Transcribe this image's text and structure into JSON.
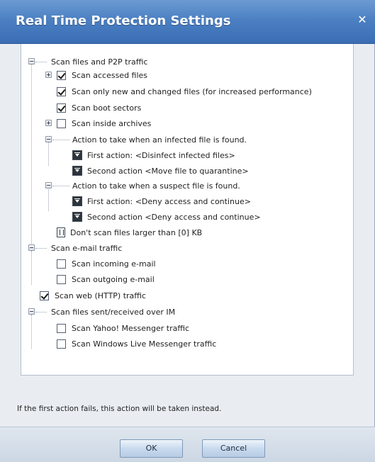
{
  "dialog": {
    "title": "Real Time Protection Settings",
    "close_label": "✕",
    "help_text": "If the first action fails, this action will be taken instead.",
    "ok_label": "OK",
    "cancel_label": "Cancel"
  },
  "tree": {
    "scan_files_p2p": "Scan files and P2P traffic",
    "scan_accessed": "Scan accessed files",
    "scan_new_changed": "Scan only new and changed files (for increased performance)",
    "scan_boot": "Scan boot sectors",
    "scan_archives": "Scan inside archives",
    "action_infected": "Action to take when an infected file is found.",
    "infected_first": "First action: <Disinfect infected files>",
    "infected_second": "Second action <Move file to quarantine>",
    "action_suspect": "Action to take when a suspect file is found.",
    "suspect_first": "First action: <Deny access and continue>",
    "suspect_second": "Second action <Deny access and continue>",
    "max_size": "Don't scan files larger than [0] KB",
    "scan_email": "Scan e-mail traffic",
    "scan_incoming": "Scan incoming e-mail",
    "scan_outgoing": "Scan outgoing e-mail",
    "scan_web": "Scan web (HTTP) traffic",
    "scan_im": "Scan files sent/received over IM",
    "scan_yahoo": "Scan Yahoo! Messenger traffic",
    "scan_wlm": "Scan Windows Live Messenger traffic"
  },
  "checked": {
    "scan_accessed": true,
    "scan_new_changed": true,
    "scan_boot": true,
    "scan_archives": false,
    "scan_incoming": false,
    "scan_outgoing": false,
    "scan_web": true,
    "scan_yahoo": false,
    "scan_wlm": false
  }
}
